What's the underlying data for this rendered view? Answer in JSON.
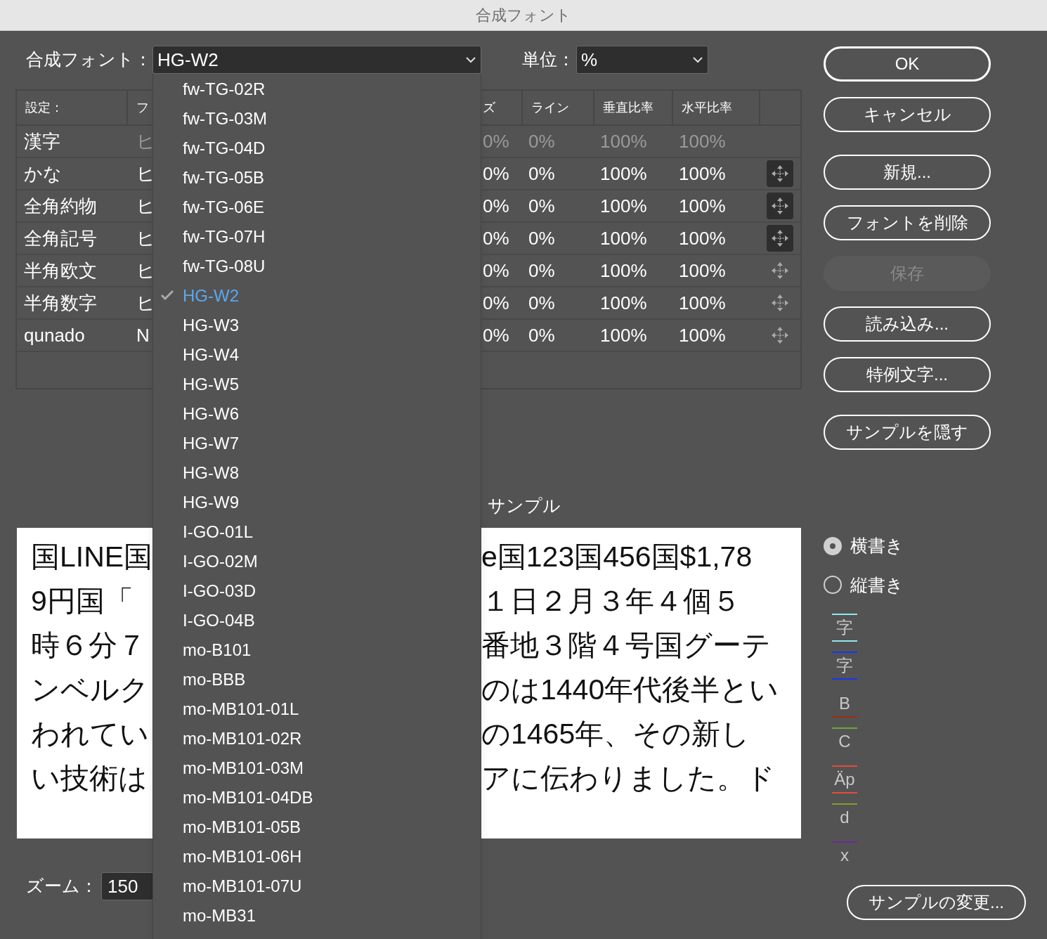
{
  "window": {
    "title": "合成フォント"
  },
  "composite_font": {
    "label": "合成フォント：",
    "value": "HG-W2"
  },
  "unit": {
    "label": "単位：",
    "value": "%"
  },
  "table": {
    "columns": {
      "setting": "設定：",
      "column_2": "フ",
      "column_3": "ズ",
      "line": "ライン",
      "vertical_ratio": "垂直比率",
      "horizontal_ratio": "水平比率"
    },
    "rows": [
      {
        "setting": "漢字",
        "column_2": "ヒ",
        "column_3": "0%",
        "line": "0%",
        "vertical_ratio": "100%",
        "horizontal_ratio": "100%",
        "dimmed": true,
        "has_move_icon": false
      },
      {
        "setting": "かな",
        "column_2": "ヒ",
        "column_3": "0%",
        "line": "0%",
        "vertical_ratio": "100%",
        "horizontal_ratio": "100%",
        "dimmed": false,
        "has_move_icon": true,
        "highlighted": true
      },
      {
        "setting": "全角約物",
        "column_2": "ヒ",
        "column_3": "0%",
        "line": "0%",
        "vertical_ratio": "100%",
        "horizontal_ratio": "100%",
        "dimmed": false,
        "has_move_icon": true,
        "highlighted": true
      },
      {
        "setting": "全角記号",
        "column_2": "ヒ",
        "column_3": "0%",
        "line": "0%",
        "vertical_ratio": "100%",
        "horizontal_ratio": "100%",
        "dimmed": false,
        "has_move_icon": true,
        "highlighted": true
      },
      {
        "setting": "半角欧文",
        "column_2": "ヒ",
        "column_3": "0%",
        "line": "0%",
        "vertical_ratio": "100%",
        "horizontal_ratio": "100%",
        "dimmed": false,
        "has_move_icon": true,
        "highlighted": false
      },
      {
        "setting": "半角数字",
        "column_2": "ヒ",
        "column_3": "0%",
        "line": "0%",
        "vertical_ratio": "100%",
        "horizontal_ratio": "100%",
        "dimmed": false,
        "has_move_icon": true,
        "highlighted": false
      },
      {
        "setting": "qunado",
        "column_2": "N",
        "column_3": "0%",
        "line": "0%",
        "vertical_ratio": "100%",
        "horizontal_ratio": "100%",
        "dimmed": false,
        "has_move_icon": true,
        "highlighted": false
      }
    ]
  },
  "sample": {
    "label": "サンプル",
    "lines": [
      {
        "left": "国LINE国",
        "right": "e国123国456国$1,78"
      },
      {
        "left": "9円国「",
        "right": "１日２月３年４個５"
      },
      {
        "left": "時６分７",
        "right": "番地３階４号国グーテ"
      },
      {
        "left": "ンベルク",
        "right": "のは1440年代後半とい"
      },
      {
        "left": "われてい",
        "right": "の1465年、その新し"
      },
      {
        "left": "い技術は",
        "right": "アに伝わりました。ド"
      }
    ]
  },
  "zoom": {
    "label": "ズーム：",
    "value": "150"
  },
  "buttons": [
    {
      "label": "OK",
      "default": true,
      "disabled": false
    },
    {
      "label": "キャンセル",
      "default": false,
      "disabled": false
    },
    {
      "label": "新規...",
      "default": false,
      "disabled": false
    },
    {
      "label": "フォントを削除",
      "default": false,
      "disabled": false
    },
    {
      "label": "保存",
      "default": false,
      "disabled": true
    },
    {
      "label": "読み込み...",
      "default": false,
      "disabled": false
    },
    {
      "label": "特例文字...",
      "default": false,
      "disabled": false
    },
    {
      "label": "サンプルを隠す",
      "default": false,
      "disabled": false
    }
  ],
  "orientation": [
    {
      "label": "横書き",
      "selected": true
    },
    {
      "label": "縦書き",
      "selected": false
    }
  ],
  "legend": [
    {
      "glyph": "字",
      "color": "#8ee8ee",
      "top_line": true,
      "bottom_line": true
    },
    {
      "glyph": "字",
      "color": "#1a35f0",
      "top_line": true,
      "bottom_line": true
    },
    {
      "glyph": "B",
      "color": "#9a3010",
      "top_line": false,
      "bottom_line": true
    },
    {
      "glyph": "C",
      "color": "#6aa83a",
      "top_line": true,
      "bottom_line": false
    },
    {
      "glyph": "Äp",
      "color": "#e84a3a",
      "top_line": true,
      "bottom_line": true
    },
    {
      "glyph": "d",
      "color": "#8a9a2a",
      "top_line": true,
      "bottom_line": false
    },
    {
      "glyph": "x",
      "color": "#6a2a9a",
      "top_line": true,
      "bottom_line": false
    }
  ],
  "change_sample_button": {
    "label": "サンプルの変更..."
  },
  "dropdown": {
    "items": [
      {
        "label": "fw-TG-02R",
        "selected": false
      },
      {
        "label": "fw-TG-03M",
        "selected": false
      },
      {
        "label": "fw-TG-04D",
        "selected": false
      },
      {
        "label": "fw-TG-05B",
        "selected": false
      },
      {
        "label": "fw-TG-06E",
        "selected": false
      },
      {
        "label": "fw-TG-07H",
        "selected": false
      },
      {
        "label": "fw-TG-08U",
        "selected": false
      },
      {
        "label": "HG-W2",
        "selected": true
      },
      {
        "label": "HG-W3",
        "selected": false
      },
      {
        "label": "HG-W4",
        "selected": false
      },
      {
        "label": "HG-W5",
        "selected": false
      },
      {
        "label": "HG-W6",
        "selected": false
      },
      {
        "label": "HG-W7",
        "selected": false
      },
      {
        "label": "HG-W8",
        "selected": false
      },
      {
        "label": "HG-W9",
        "selected": false
      },
      {
        "label": "I-GO-01L",
        "selected": false
      },
      {
        "label": "I-GO-02M",
        "selected": false
      },
      {
        "label": "I-GO-03D",
        "selected": false
      },
      {
        "label": "I-GO-04B",
        "selected": false
      },
      {
        "label": "mo-B101",
        "selected": false
      },
      {
        "label": "mo-BBB",
        "selected": false
      },
      {
        "label": "mo-MB101-01L",
        "selected": false
      },
      {
        "label": "mo-MB101-02R",
        "selected": false
      },
      {
        "label": "mo-MB101-03M",
        "selected": false
      },
      {
        "label": "mo-MB101-04DB",
        "selected": false
      },
      {
        "label": "mo-MB101-05B",
        "selected": false
      },
      {
        "label": "mo-MB101-06H",
        "selected": false
      },
      {
        "label": "mo-MB101-07U",
        "selected": false
      },
      {
        "label": "mo-MB31",
        "selected": false
      }
    ]
  }
}
